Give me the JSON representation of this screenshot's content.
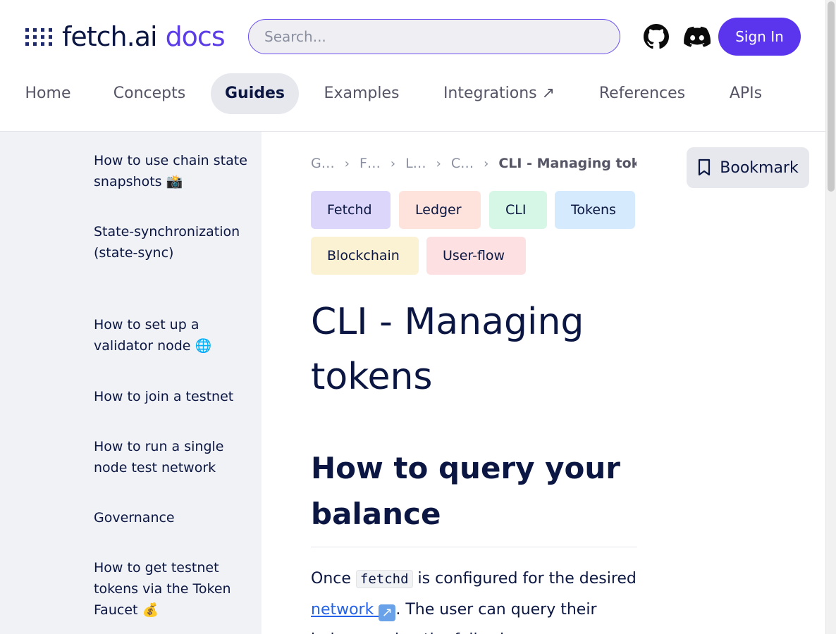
{
  "logo": {
    "fetch": "fetch.ai",
    "docs": "docs"
  },
  "search": {
    "placeholder": "Search..."
  },
  "header": {
    "signin_label": "Sign In"
  },
  "nav": {
    "items": [
      {
        "label": "Home"
      },
      {
        "label": "Concepts"
      },
      {
        "label": "Guides"
      },
      {
        "label": "Examples"
      },
      {
        "label": "Integrations ↗"
      },
      {
        "label": "References"
      },
      {
        "label": "APIs"
      }
    ],
    "active": "Guides"
  },
  "sidebar": {
    "items": [
      {
        "label": "How to use chain state snapshots 📸"
      },
      {
        "label": "State-synchronization (state-sync)"
      },
      {
        "label": "How to set up a validator node 🌐"
      },
      {
        "label": "How to join a testnet"
      },
      {
        "label": "How to run a single node test network"
      },
      {
        "label": "Governance"
      },
      {
        "label": "How to get testnet tokens via the Token Faucet 💰"
      }
    ]
  },
  "breadcrumb": {
    "items": [
      "G…",
      "F…",
      "L…",
      "C…"
    ],
    "current": "CLI - Managing tok"
  },
  "bookmark_label": "Bookmark",
  "tags": [
    {
      "label": "Fetchd",
      "color": "#ddd6fb"
    },
    {
      "label": "Ledger",
      "color": "#fde3dc"
    },
    {
      "label": "CLI",
      "color": "#d7f7e6"
    },
    {
      "label": "Tokens",
      "color": "#d6eafd"
    },
    {
      "label": "Blockchain",
      "color": "#fbf1d3"
    },
    {
      "label": "User-flow",
      "color": "#fde0e1"
    }
  ],
  "article": {
    "title": "CLI - Managing tokens",
    "section_heading": "How to query your balance",
    "para_prefix": "Once ",
    "para_code": "fetchd",
    "para_mid": " is configured for the desired ",
    "para_link": "network",
    "para_suffix": ". The user can query their balance using the following"
  }
}
